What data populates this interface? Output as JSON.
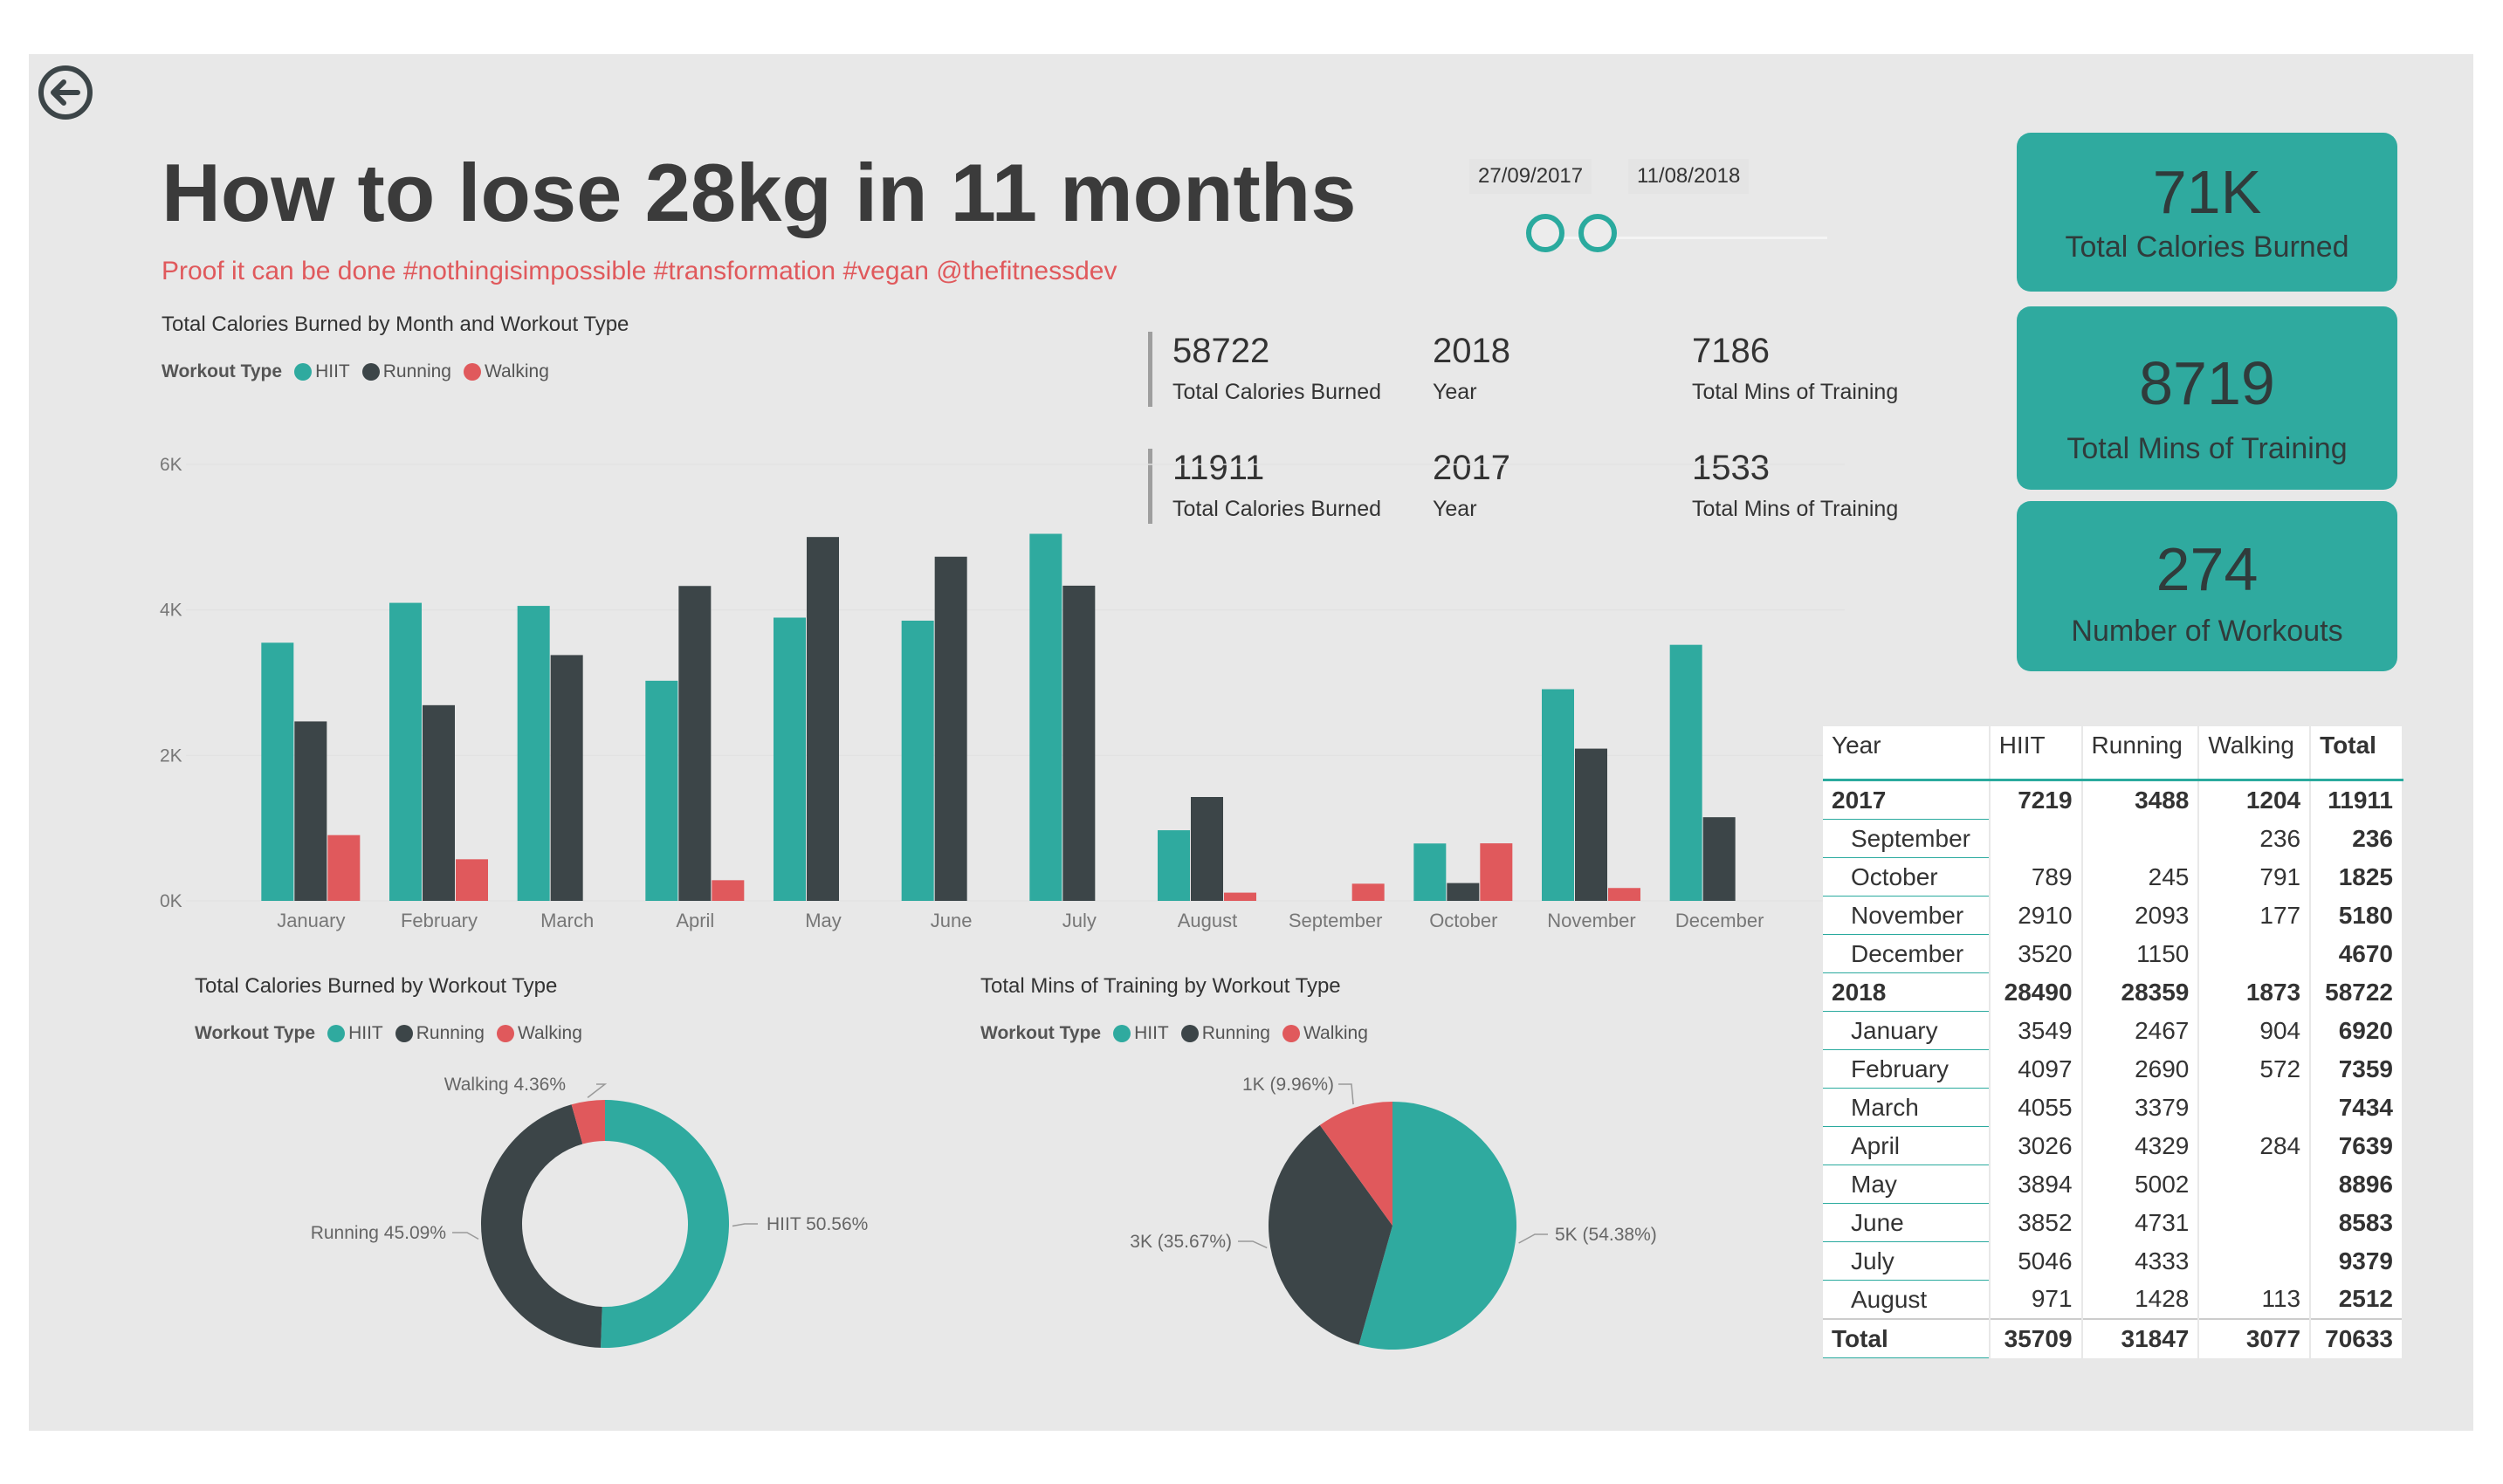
{
  "title": "How to lose 28kg in 11 months",
  "subtitle": "Proof it can be done #nothingisimpossible #transformation #vegan @thefitnessdev",
  "colors": {
    "HIIT": "#2faa9f",
    "Running": "#3c4548",
    "Walking": "#e0595c"
  },
  "date_slicer": {
    "start": "27/09/2017",
    "end": "11/08/2018"
  },
  "legend": {
    "label": "Workout Type",
    "items": [
      "HIIT",
      "Running",
      "Walking"
    ]
  },
  "stats": [
    {
      "calories": "58722",
      "calories_label": "Total Calories Burned",
      "year": "2018",
      "year_label": "Year",
      "mins": "7186",
      "mins_label": "Total Mins of Training"
    },
    {
      "calories": "11911",
      "calories_label": "Total Calories Burned",
      "year": "2017",
      "year_label": "Year",
      "mins": "1533",
      "mins_label": "Total Mins of Training"
    }
  ],
  "kpis": [
    {
      "value": "71K",
      "label": "Total Calories Burned"
    },
    {
      "value": "8719",
      "label": "Total Mins of Training"
    },
    {
      "value": "274",
      "label": "Number of Workouts"
    }
  ],
  "matrix": {
    "headers": [
      "Year",
      "HIIT",
      "Running",
      "Walking",
      "Total"
    ],
    "rows": [
      {
        "label": "2017",
        "level": "year",
        "values": [
          "7219",
          "3488",
          "1204",
          "11911"
        ]
      },
      {
        "label": "September",
        "level": "month",
        "values": [
          "",
          "",
          "236",
          "236"
        ]
      },
      {
        "label": "October",
        "level": "month",
        "values": [
          "789",
          "245",
          "791",
          "1825"
        ]
      },
      {
        "label": "November",
        "level": "month",
        "values": [
          "2910",
          "2093",
          "177",
          "5180"
        ]
      },
      {
        "label": "December",
        "level": "month",
        "values": [
          "3520",
          "1150",
          "",
          "4670"
        ]
      },
      {
        "label": "2018",
        "level": "year",
        "values": [
          "28490",
          "28359",
          "1873",
          "58722"
        ]
      },
      {
        "label": "January",
        "level": "month",
        "values": [
          "3549",
          "2467",
          "904",
          "6920"
        ]
      },
      {
        "label": "February",
        "level": "month",
        "values": [
          "4097",
          "2690",
          "572",
          "7359"
        ]
      },
      {
        "label": "March",
        "level": "month",
        "values": [
          "4055",
          "3379",
          "",
          "7434"
        ]
      },
      {
        "label": "April",
        "level": "month",
        "values": [
          "3026",
          "4329",
          "284",
          "7639"
        ]
      },
      {
        "label": "May",
        "level": "month",
        "values": [
          "3894",
          "5002",
          "",
          "8896"
        ]
      },
      {
        "label": "June",
        "level": "month",
        "values": [
          "3852",
          "4731",
          "",
          "8583"
        ]
      },
      {
        "label": "July",
        "level": "month",
        "values": [
          "5046",
          "4333",
          "",
          "9379"
        ]
      },
      {
        "label": "August",
        "level": "month",
        "values": [
          "971",
          "1428",
          "113",
          "2512"
        ]
      },
      {
        "label": "Total",
        "level": "grand",
        "values": [
          "35709",
          "31847",
          "3077",
          "70633"
        ]
      }
    ]
  },
  "chart_data": [
    {
      "type": "bar",
      "title": "Total Calories Burned by Month and Workout Type",
      "legend_title": "Workout Type",
      "categories": [
        "January",
        "February",
        "March",
        "April",
        "May",
        "June",
        "July",
        "August",
        "September",
        "October",
        "November",
        "December"
      ],
      "series": [
        {
          "name": "HIIT",
          "values": [
            3549,
            4097,
            4055,
            3026,
            3894,
            3852,
            5046,
            971,
            0,
            789,
            2910,
            3520
          ]
        },
        {
          "name": "Running",
          "values": [
            2467,
            2690,
            3379,
            4329,
            5002,
            4731,
            4333,
            1428,
            0,
            245,
            2093,
            1150
          ]
        },
        {
          "name": "Walking",
          "values": [
            904,
            572,
            0,
            284,
            0,
            0,
            0,
            113,
            236,
            791,
            177,
            0
          ]
        }
      ],
      "yticks": [
        "0K",
        "2K",
        "4K",
        "6K"
      ],
      "ylim": [
        0,
        6000
      ],
      "legend_position": "top-left"
    },
    {
      "type": "pie",
      "variant": "donut",
      "title": "Total Calories Burned by Workout Type",
      "legend_title": "Workout Type",
      "labels": [
        "HIIT",
        "Running",
        "Walking"
      ],
      "values": [
        50.56,
        45.09,
        4.36
      ],
      "data_labels": [
        "HIIT 50.56%",
        "Running 45.09%",
        "Walking 4.36%"
      ]
    },
    {
      "type": "pie",
      "title": "Total Mins of Training by Workout Type",
      "legend_title": "Workout Type",
      "labels": [
        "HIIT",
        "Running",
        "Walking"
      ],
      "values": [
        54.38,
        35.67,
        9.96
      ],
      "data_labels": [
        "5K (54.38%)",
        "3K (35.67%)",
        "1K (9.96%)"
      ]
    }
  ]
}
